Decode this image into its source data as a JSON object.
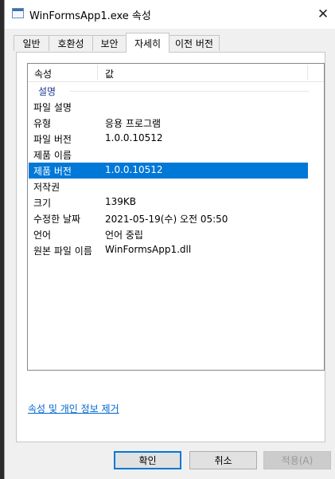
{
  "window": {
    "title": "WinFormsApp1.exe 속성",
    "close_glyph": "✕"
  },
  "tabs": [
    {
      "label": "일반"
    },
    {
      "label": "호환성"
    },
    {
      "label": "보안"
    },
    {
      "label": "자세히",
      "active": true
    },
    {
      "label": "이전 버전"
    }
  ],
  "list": {
    "header": {
      "property": "속성",
      "value": "값"
    },
    "group": "설명",
    "rows": [
      {
        "key": "파일 설명",
        "value": ""
      },
      {
        "key": "유형",
        "value": "응용 프로그램"
      },
      {
        "key": "파일 버전",
        "value": "1.0.0.10512"
      },
      {
        "key": "제품 이름",
        "value": ""
      },
      {
        "key": "제품 버전",
        "value": "1.0.0.10512",
        "selected": true
      },
      {
        "key": "저작권",
        "value": ""
      },
      {
        "key": "크기",
        "value": "139KB"
      },
      {
        "key": "수정한 날짜",
        "value": "2021-05-19(수) 오전 05:50"
      },
      {
        "key": "언어",
        "value": "언어 중립"
      },
      {
        "key": "원본 파일 이름",
        "value": "WinFormsApp1.dll"
      }
    ]
  },
  "remove_link": "속성 및 개인 정보 제거",
  "buttons": {
    "ok": "확인",
    "cancel": "취소",
    "apply": "적용(A)"
  },
  "colors": {
    "selection": "#0078d7",
    "link": "#0066cc",
    "group_header": "#1e3c8c"
  }
}
